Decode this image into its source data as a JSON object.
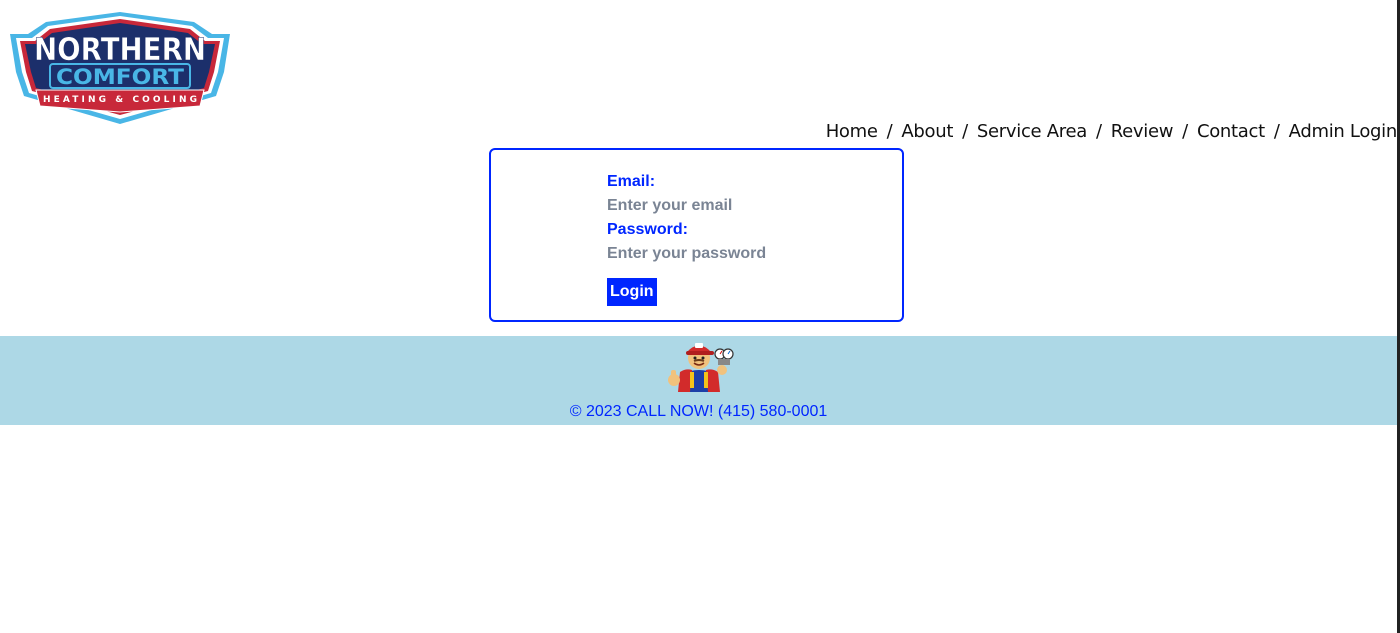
{
  "logo": {
    "line1": "NORTHERN",
    "line2": "COMFORT",
    "line3": "HEATING & COOLING",
    "colors": {
      "navy": "#1c2f6b",
      "sky": "#49b6e6",
      "red": "#c8283a",
      "white": "#ffffff"
    }
  },
  "nav": {
    "items": [
      {
        "label": "Home"
      },
      {
        "label": "About"
      },
      {
        "label": "Service Area"
      },
      {
        "label": "Review"
      },
      {
        "label": "Contact"
      },
      {
        "label": "Admin Login"
      }
    ],
    "separator": "/"
  },
  "login": {
    "email_label": "Email:",
    "email_placeholder": "Enter your email",
    "email_value": "",
    "password_label": "Password:",
    "password_placeholder": "Enter your password",
    "password_value": "",
    "submit_label": "Login",
    "accent_color": "#0026ff"
  },
  "footer": {
    "text": "© 2023 CALL NOW! (415) 580-0001",
    "background": "#add8e6",
    "mascot_icon": "technician-mascot-icon"
  }
}
